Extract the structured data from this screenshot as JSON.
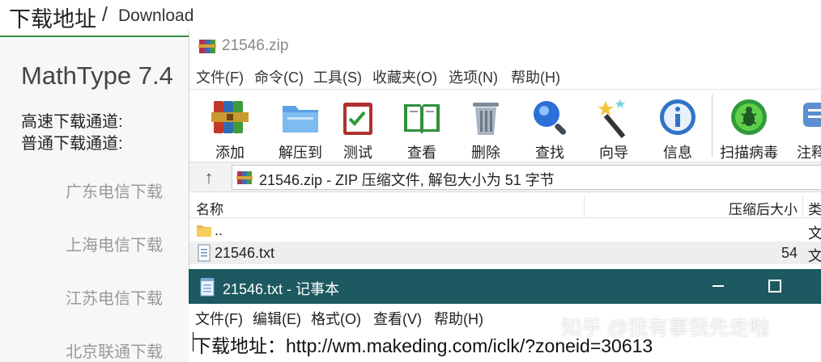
{
  "web": {
    "header_title": "下载地址",
    "header_sep": "/",
    "header_sub": "Download",
    "product": "MathType 7.4",
    "fast_channel": "高速下载通道:",
    "normal_channel": "普通下载通道:",
    "mirrors": [
      "广东电信下载",
      "上海电信下载",
      "江苏电信下载",
      "北京联通下载"
    ]
  },
  "winrar": {
    "title": "21546.zip",
    "menu": [
      "文件(F)",
      "命令(C)",
      "工具(S)",
      "收藏夹(O)",
      "选项(N)",
      "帮助(H)"
    ],
    "toolbar": [
      {
        "label": "添加",
        "icon": "add-archive-icon"
      },
      {
        "label": "解压到",
        "icon": "extract-to-icon"
      },
      {
        "label": "测试",
        "icon": "test-icon"
      },
      {
        "label": "查看",
        "icon": "view-icon"
      },
      {
        "label": "删除",
        "icon": "delete-icon"
      },
      {
        "label": "查找",
        "icon": "find-icon"
      },
      {
        "label": "向导",
        "icon": "wizard-icon"
      },
      {
        "label": "信息",
        "icon": "info-icon"
      },
      {
        "label": "扫描病毒",
        "icon": "virus-scan-icon"
      },
      {
        "label": "注释",
        "icon": "comment-icon"
      }
    ],
    "address": "21546.zip - ZIP 压缩文件, 解包大小为 51 字节",
    "columns": {
      "name": "名称",
      "packed": "压缩后大小",
      "type": "类"
    },
    "rows": [
      {
        "name": "..",
        "size": "",
        "type": "文"
      },
      {
        "name": "21546.txt",
        "size": "54",
        "type": "文"
      }
    ]
  },
  "notepad": {
    "title": "21546.txt - 记事本",
    "menu": [
      "文件(F)",
      "编辑(E)",
      "格式(O)",
      "查看(V)",
      "帮助(H)"
    ],
    "content": "下载地址：http://wm.makeding.com/iclk/?zoneid=30613"
  },
  "watermark": "知乎 @我有事我先走啦",
  "colors": {
    "notepad_title_bg": "#1d5960",
    "header_accent": "#2e8b3d"
  }
}
